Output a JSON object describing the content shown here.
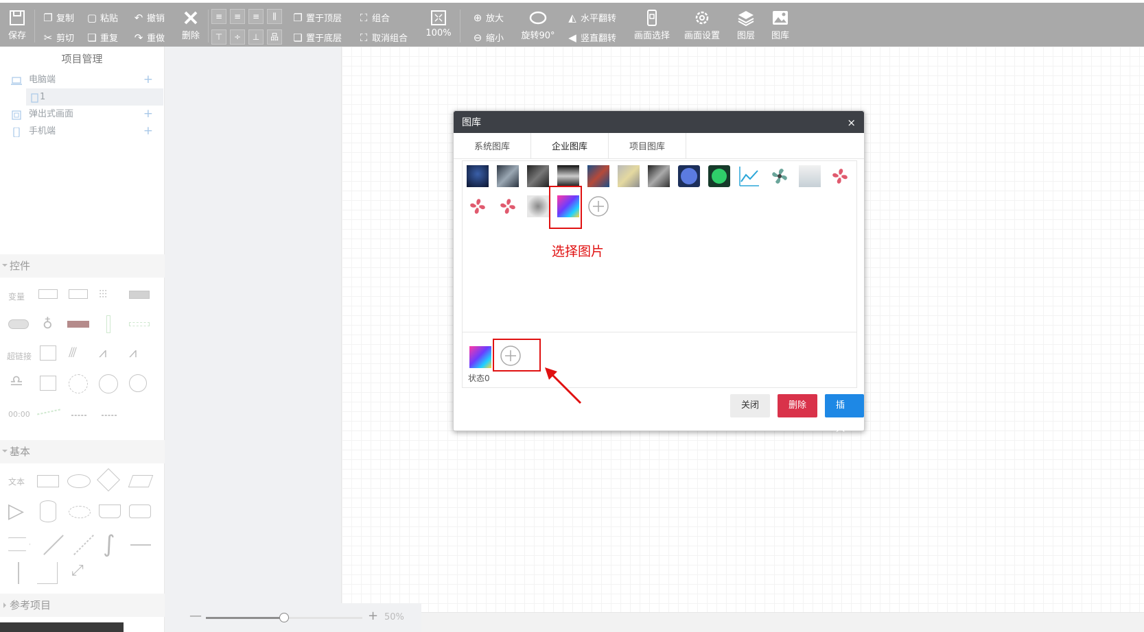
{
  "toolbar": {
    "save": "保存",
    "copy": "复制",
    "cut": "剪切",
    "paste": "粘贴",
    "repeat": "重复",
    "undo": "撤销",
    "redo": "重做",
    "delete": "删除",
    "bring_top": "置于顶层",
    "send_bottom": "置于底层",
    "group": "组合",
    "ungroup": "取消组合",
    "zoom_level": "100%",
    "zoom_in": "放大",
    "zoom_out": "缩小",
    "rotate": "旋转90°",
    "flip_h": "水平翻转",
    "flip_v": "竖直翻转",
    "screen_select": "画面选择",
    "screen_settings": "画面设置",
    "layers": "图层",
    "gallery": "图库"
  },
  "sidebar": {
    "title": "项目管理",
    "tree": [
      {
        "label": "电脑端"
      },
      {
        "label": "1"
      },
      {
        "label": "弹出式画面"
      },
      {
        "label": "手机端"
      }
    ],
    "sections": {
      "controls": "控件",
      "basic": "基本",
      "reference": "参考项目"
    },
    "control_labels": {
      "variable": "变量",
      "hyperlink": "超链接",
      "time": "00:00"
    },
    "basic_labels": {
      "text": "文本"
    }
  },
  "zoom": {
    "value": "50%",
    "level": 0.5
  },
  "dialog": {
    "title": "图库",
    "close": "×",
    "tabs": [
      "系统图库",
      "企业图库",
      "项目图库"
    ],
    "state_label": "状态0",
    "buttons": {
      "close": "关闭",
      "delete": "删除",
      "insert": "插入"
    }
  },
  "annotation": {
    "text": "选择图片"
  },
  "colors": {
    "accent_red": "#e01010",
    "insert_blue": "#1e88e5",
    "delete_red": "#d9324a"
  }
}
